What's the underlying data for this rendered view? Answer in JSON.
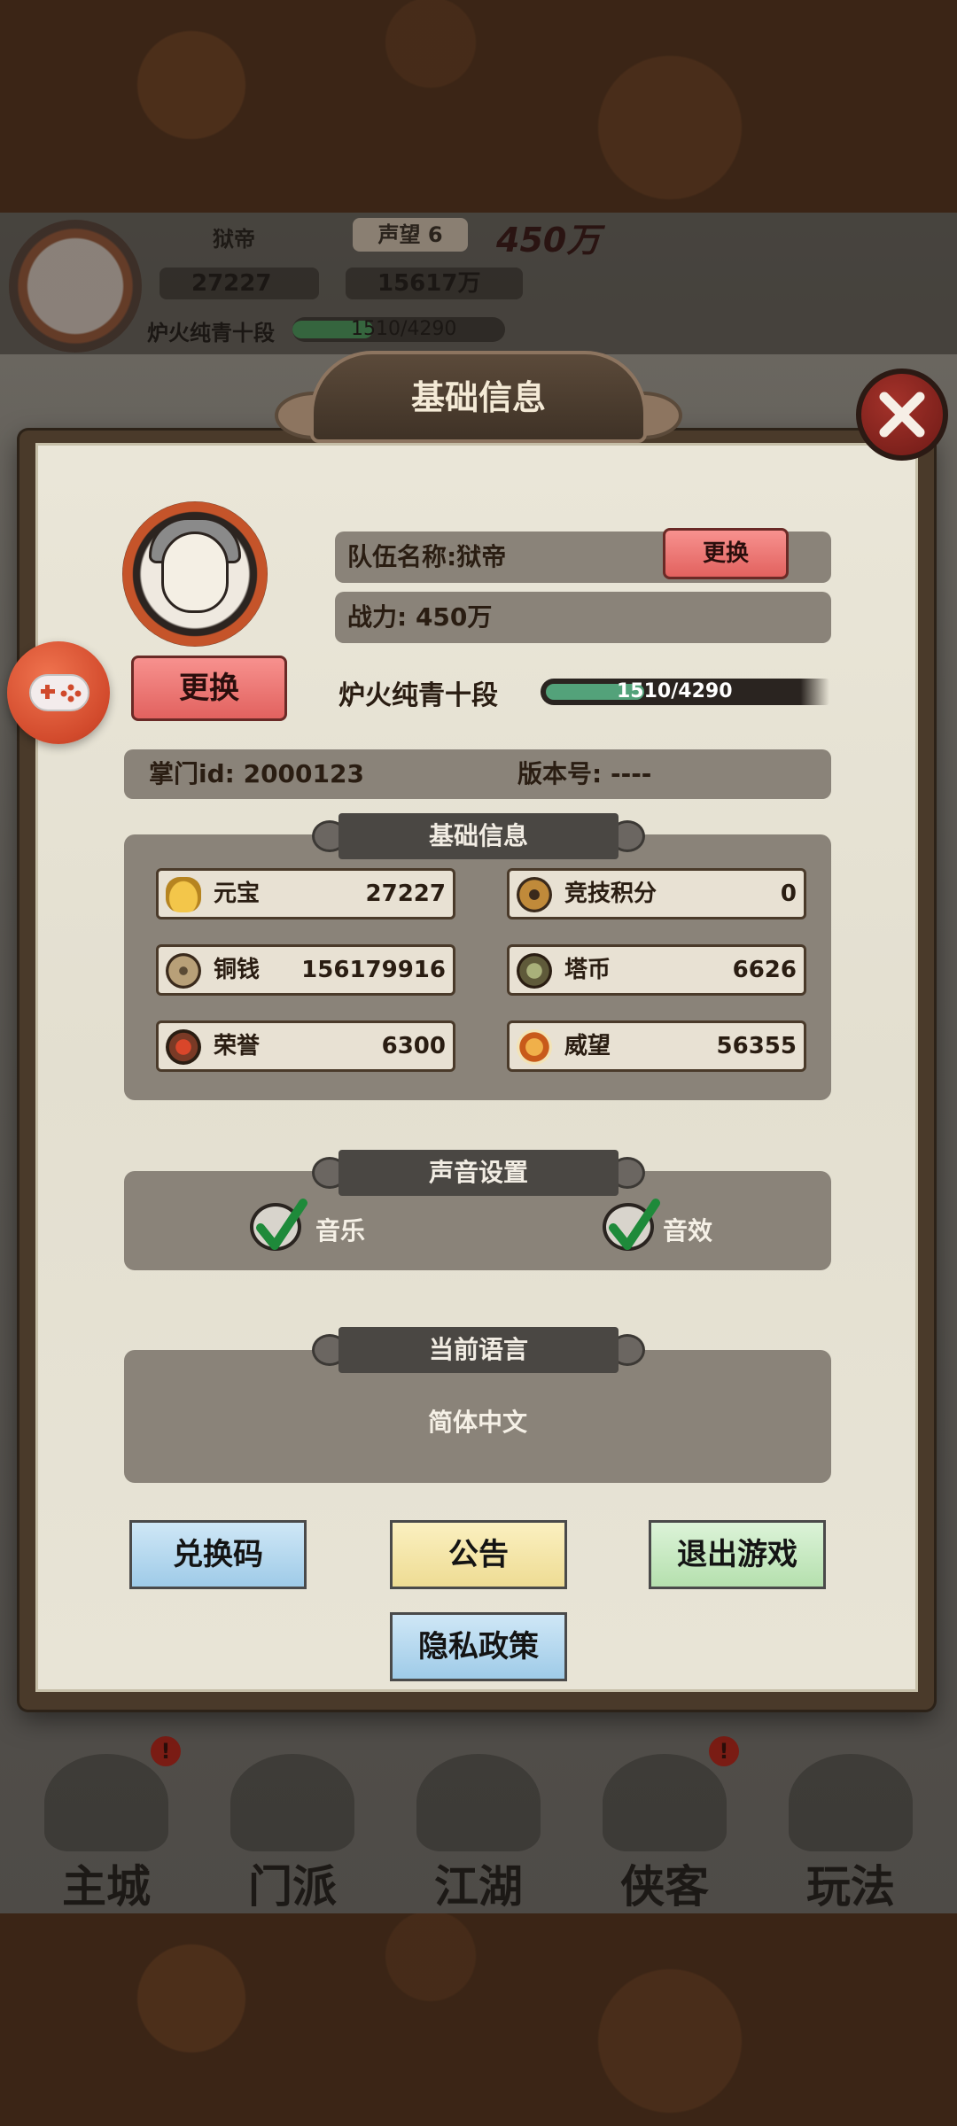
{
  "hud": {
    "name": "狱帝",
    "reputation": "声望 6",
    "power": "450万",
    "gold": "27227",
    "coins": "15617万",
    "rank": "炉火纯青十段",
    "rank_progress": "1510/4290"
  },
  "nav": [
    {
      "label": "主城",
      "badge": "!"
    },
    {
      "label": "门派",
      "badge": ""
    },
    {
      "label": "江湖",
      "badge": ""
    },
    {
      "label": "侠客",
      "badge": "!"
    },
    {
      "label": "玩法",
      "badge": ""
    }
  ],
  "panel": {
    "title": "基础信息",
    "change_avatar_label": "更换",
    "team_name": "队伍名称:狱帝",
    "change_team_label": "更换",
    "power": "战力: 450万",
    "rank_label": "炉火纯青十段",
    "rank_progress_text": "1510/4290",
    "rank_progress_fraction": 0.352,
    "id_text": "掌门id: 2000123",
    "version_text": "版本号: ----"
  },
  "basic_info": {
    "header": "基础信息",
    "items": [
      {
        "name": "元宝",
        "value": "27227",
        "icon": "gold-ingot-icon"
      },
      {
        "name": "竞技积分",
        "value": "0",
        "icon": "arena-medal-icon"
      },
      {
        "name": "铜钱",
        "value": "156179916",
        "icon": "copper-coin-icon"
      },
      {
        "name": "塔币",
        "value": "6626",
        "icon": "tower-coin-icon"
      },
      {
        "name": "荣誉",
        "value": "6300",
        "icon": "honor-icon"
      },
      {
        "name": "威望",
        "value": "56355",
        "icon": "prestige-icon"
      }
    ]
  },
  "sound": {
    "header": "声音设置",
    "music_label": "音乐",
    "sfx_label": "音效",
    "music_on": true,
    "sfx_on": true
  },
  "language": {
    "header": "当前语言",
    "value": "简体中文"
  },
  "buttons": {
    "redeem": "兑换码",
    "notice": "公告",
    "exit": "退出游戏",
    "privacy": "隐私政策"
  },
  "colors": {
    "accent_red": "#e2625f",
    "progress_green": "#53a27a",
    "panel_bg": "#e3dfd0"
  }
}
